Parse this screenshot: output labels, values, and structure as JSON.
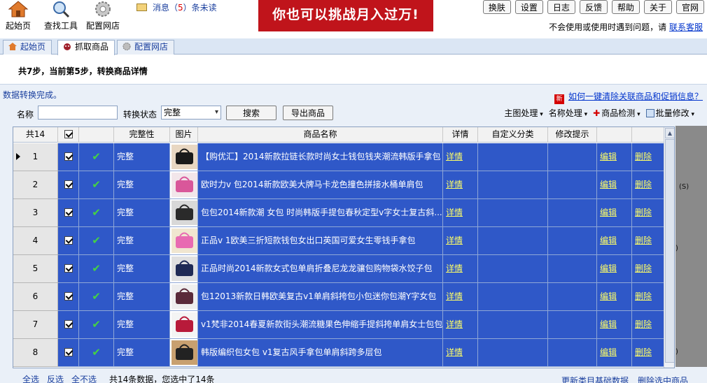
{
  "toolbar": {
    "home_label": "起始页",
    "find_label": "查找工具",
    "config_label": "配置网店",
    "message_prefix": "消息（",
    "message_count": "5",
    "message_suffix": "）条未读",
    "banner_text": "你也可以挑战月入过万!",
    "sys_buttons": [
      "换肤",
      "设置",
      "日志",
      "反馈",
      "帮助",
      "关于",
      "官网"
    ],
    "help_text": "不会使用或使用时遇到问题，请",
    "help_link": "联系客服"
  },
  "tabs": [
    "起始页",
    "抓取商品",
    "配置网店"
  ],
  "step_text": "共7步，当前第5步，转换商品详情",
  "status_text": "数据转换完成。",
  "hot_link": "如何一键清除关联商品和促销信息？",
  "filters": {
    "name_label": "名称",
    "name_value": "",
    "status_label": "转换状态",
    "status_value": "完整",
    "search_button": "搜索",
    "export_button": "导出商品"
  },
  "right_menus": [
    "主图处理",
    "名称处理",
    "商品检测",
    "批量修改"
  ],
  "grid": {
    "headers": {
      "count": "共14",
      "status": "完整性",
      "image": "图片",
      "name": "商品名称",
      "detail": "详情",
      "category": "自定义分类",
      "hint": "修改提示"
    },
    "rows": [
      {
        "idx": "1",
        "status": "完整",
        "name": "【购优汇】2014新款拉链长款时尚女士钱包钱夹潮流韩版手拿包",
        "detail": "详情",
        "edit": "编辑",
        "del": "删除"
      },
      {
        "idx": "2",
        "status": "完整",
        "name": "欧时力v 包2014新款欧美大牌马卡龙色撞色拼接水桶单肩包",
        "detail": "详情",
        "edit": "编辑",
        "del": "删除"
      },
      {
        "idx": "3",
        "status": "完整",
        "name": "包包2014新款潮 女包 时尚韩版手提包春秋定型v字女士复古斜...",
        "detail": "详情",
        "edit": "编辑",
        "del": "删除"
      },
      {
        "idx": "4",
        "status": "完整",
        "name": "正品v 1欧美三折短款钱包女出口英国可爱女生零钱手拿包",
        "detail": "详情",
        "edit": "编辑",
        "del": "删除"
      },
      {
        "idx": "5",
        "status": "完整",
        "name": "正品时尚2014新款女式包单肩折叠尼龙龙骧包购物袋水饺子包",
        "detail": "详情",
        "edit": "编辑",
        "del": "删除"
      },
      {
        "idx": "6",
        "status": "完整",
        "name": "包12013新款日韩欧美复古v1单肩斜挎包小包迷你包潮Y字女包",
        "detail": "详情",
        "edit": "编辑",
        "del": "删除"
      },
      {
        "idx": "7",
        "status": "完整",
        "name": "v1梵非2014春夏新款街头潮流糖果色伸缩手提斜挎单肩女士包包",
        "detail": "详情",
        "edit": "编辑",
        "del": "删除"
      },
      {
        "idx": "8",
        "status": "完整",
        "name": "韩版编织包女包 v1复古风手拿包单肩斜跨多层包",
        "detail": "详情",
        "edit": "编辑",
        "del": "删除"
      }
    ]
  },
  "footer": {
    "select_all": "全选",
    "invert": "反选",
    "select_none": "全不选",
    "summary": "共14条数据，您选中了14条",
    "update_category": "更新类目基础数据",
    "delete_selected": "删除选中商品"
  },
  "colors": {
    "row_bg": "#2f58c8",
    "link_yellow": "#ffff66",
    "banner_red": "#c0141b",
    "accent_blue": "#1a3f9e"
  }
}
